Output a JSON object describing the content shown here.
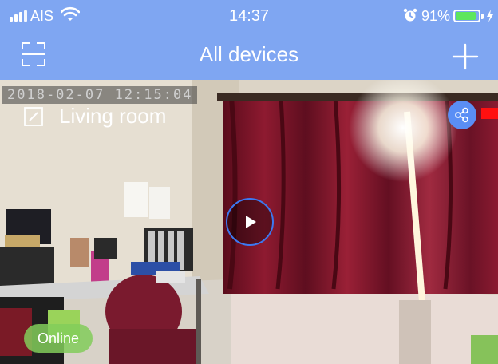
{
  "status_bar": {
    "carrier": "AIS",
    "time": "14:37",
    "battery_percent": "91%",
    "battery_level": 0.91,
    "icons": [
      "signal-icon",
      "wifi-icon",
      "alarm-icon",
      "battery-icon",
      "charging-icon"
    ]
  },
  "nav": {
    "title": "All devices",
    "left_icon": "scan-icon",
    "right_icon": "add-icon"
  },
  "device": {
    "timestamp": "2018-02-07  12:15:04",
    "name": "Living room",
    "status": "Online",
    "icons": [
      "edit-icon",
      "share-icon",
      "play-icon"
    ]
  },
  "colors": {
    "header": "#7fa6f2",
    "share_button": "#5a8ef5",
    "play_ring": "#3c78f0",
    "online_badge": "#82cd5a",
    "rec_mark": "#ff1010"
  }
}
